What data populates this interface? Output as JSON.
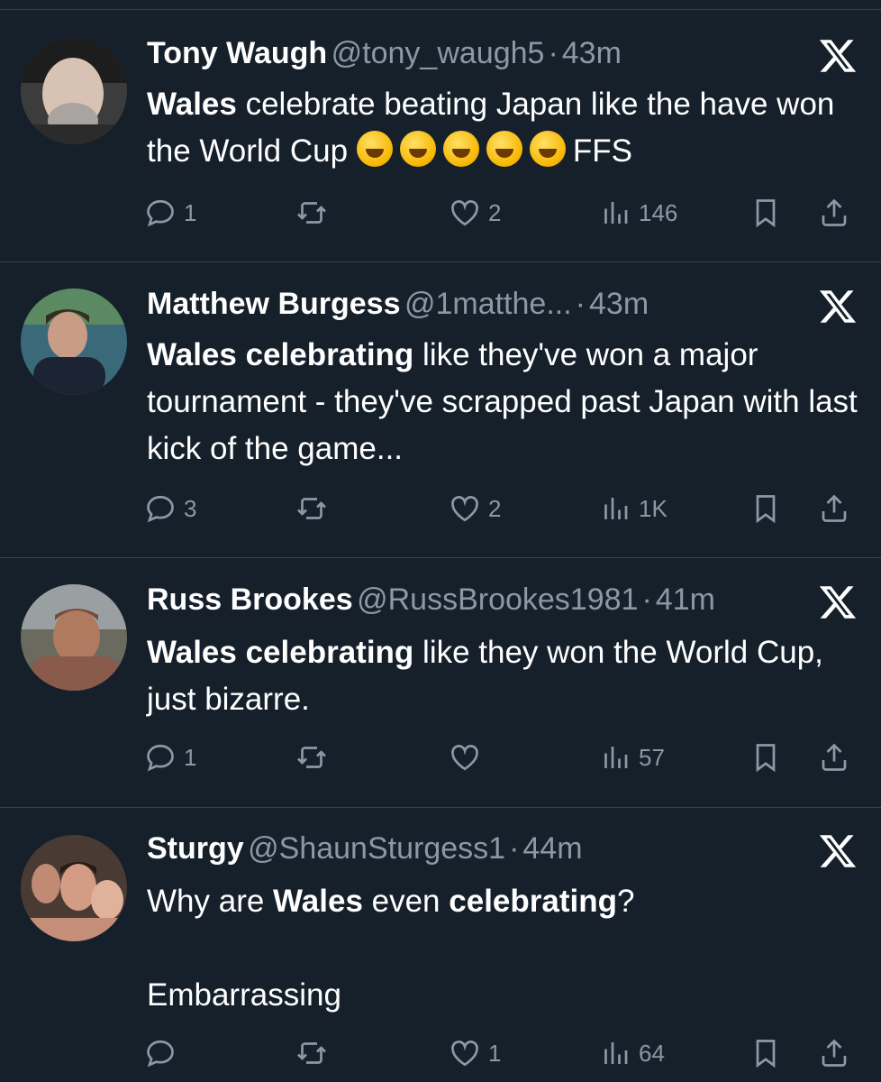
{
  "tweets": [
    {
      "name": "Tony Waugh",
      "handle": "@tony_waugh5",
      "dot": "·",
      "time": "43m",
      "text_parts": [
        {
          "bold": true,
          "text": "Wales"
        },
        {
          "bold": false,
          "text": " celebrate beating Japan like the have won the World Cup "
        },
        {
          "bold": false,
          "text": "FFS"
        }
      ],
      "emoji_count": 5,
      "emoji": "rolling-on-floor-laughing",
      "replies": "1",
      "retweets": "",
      "likes": "2",
      "views": "146"
    },
    {
      "name": "Matthew Burgess",
      "handle": "@1matthe...",
      "dot": "·",
      "time": "43m",
      "text_parts": [
        {
          "bold": true,
          "text": "Wales celebrating"
        },
        {
          "bold": false,
          "text": " like they've won a major tournament - they've scrapped past Japan with last kick of the game..."
        }
      ],
      "replies": "3",
      "retweets": "",
      "likes": "2",
      "views": "1K"
    },
    {
      "name": "Russ Brookes",
      "handle": "@RussBrookes1981",
      "dot": "·",
      "time": "41m",
      "text_parts": [
        {
          "bold": true,
          "text": "Wales celebrating"
        },
        {
          "bold": false,
          "text": " like they won the World Cup, just bizarre."
        }
      ],
      "replies": "1",
      "retweets": "",
      "likes": "",
      "views": "57"
    },
    {
      "name": "Sturgy",
      "handle": "@ShaunSturgess1",
      "dot": "·",
      "time": "44m",
      "text_parts": [
        {
          "bold": false,
          "text": "Why are "
        },
        {
          "bold": true,
          "text": "Wales"
        },
        {
          "bold": false,
          "text": " even "
        },
        {
          "bold": true,
          "text": "celebrating"
        },
        {
          "bold": false,
          "text": "?"
        }
      ],
      "text_line2": "Embarrassing",
      "replies": "",
      "retweets": "",
      "likes": "1",
      "views": "64"
    }
  ],
  "icons": {
    "platform_logo": "x-logo",
    "reply": "reply-bubble-icon",
    "retweet": "retweet-icon",
    "like": "heart-icon",
    "views": "views-bar-chart-icon",
    "bookmark": "bookmark-icon",
    "share": "share-icon"
  },
  "colors": {
    "background": "#15202b",
    "text": "#ffffff",
    "muted": "#8b98a5",
    "divider": "#38444d"
  }
}
